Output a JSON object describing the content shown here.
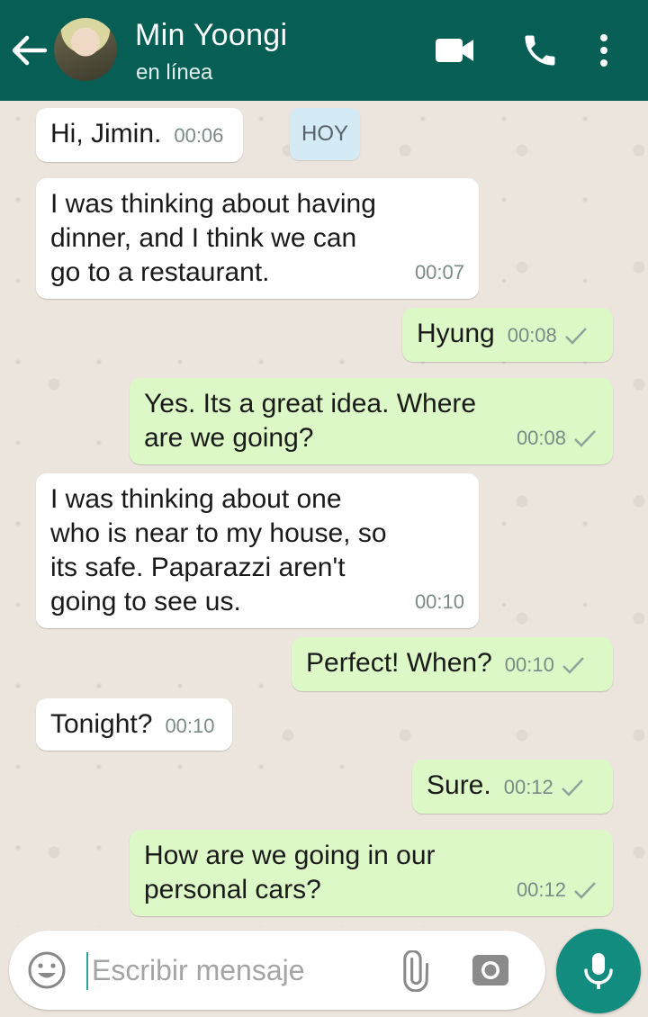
{
  "header": {
    "contact_name": "Min Yoongi",
    "status": "en línea",
    "icons": [
      "back-arrow-icon",
      "video-call-icon",
      "voice-call-icon",
      "more-options-icon"
    ]
  },
  "chat": {
    "date_chip": "HOY",
    "messages": [
      {
        "direction": "in",
        "text": "Hi, Jimin.",
        "time": "00:06"
      },
      {
        "direction": "in",
        "text": "I was thinking about having\ndinner, and I think we can\ngo to a restaurant.",
        "time": "00:07"
      },
      {
        "direction": "out",
        "text": "Hyung",
        "time": "00:08",
        "status": "sent"
      },
      {
        "direction": "out",
        "text": "Yes. Its a great idea. Where\nare we going?",
        "time": "00:08",
        "status": "sent"
      },
      {
        "direction": "in",
        "text": "I was thinking about one\nwho is near to my house, so\nits safe. Paparazzi aren't\ngoing to see us.",
        "time": "00:10"
      },
      {
        "direction": "out",
        "text": "Perfect! When?",
        "time": "00:10",
        "status": "sent"
      },
      {
        "direction": "in",
        "text": "Tonight?",
        "time": "00:10"
      },
      {
        "direction": "out",
        "text": "Sure.",
        "time": "00:12",
        "status": "sent"
      },
      {
        "direction": "out",
        "text": "How are we going in our\npersonal cars?",
        "time": "00:12",
        "status": "sent"
      }
    ]
  },
  "composer": {
    "placeholder": "Escribir mensaje",
    "value": "",
    "icons": [
      "emoji-icon",
      "attach-icon",
      "camera-icon",
      "microphone-icon"
    ]
  },
  "colors": {
    "header": "#075e54",
    "incoming_bubble": "#ffffff",
    "outgoing_bubble": "#dcf8c6",
    "mic_button": "#128c7e",
    "chat_background": "#ece5dd"
  }
}
